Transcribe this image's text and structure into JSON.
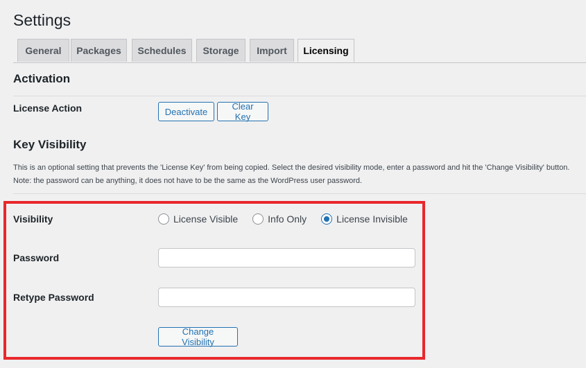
{
  "header": {
    "title": "Settings"
  },
  "tabs": [
    {
      "label": "General",
      "active": false
    },
    {
      "label": "Packages",
      "active": false
    },
    {
      "label": "Schedules",
      "active": false
    },
    {
      "label": "Storage",
      "active": false
    },
    {
      "label": "Import",
      "active": false
    },
    {
      "label": "Licensing",
      "active": true
    }
  ],
  "activation": {
    "title": "Activation",
    "license_action_label": "License Action",
    "deactivate_label": "Deactivate",
    "clear_key_label": "Clear Key"
  },
  "key_visibility": {
    "title": "Key Visibility",
    "description_line1": "This is an optional setting that prevents the 'License Key' from being copied. Select the desired visibility mode, enter a password and hit the 'Change Visibility' button.",
    "description_line2": "Note: the password can be anything, it does not have to be the same as the WordPress user password.",
    "visibility_label": "Visibility",
    "options": [
      {
        "label": "License Visible",
        "checked": false
      },
      {
        "label": "Info Only",
        "checked": false
      },
      {
        "label": "License Invisible",
        "checked": true
      }
    ],
    "password_label": "Password",
    "password_value": "",
    "retype_password_label": "Retype Password",
    "retype_password_value": "",
    "change_visibility_label": "Change Visibility"
  },
  "colors": {
    "accent": "#2271b1",
    "highlight_border": "#e8282b",
    "background": "#f0f0f1"
  }
}
